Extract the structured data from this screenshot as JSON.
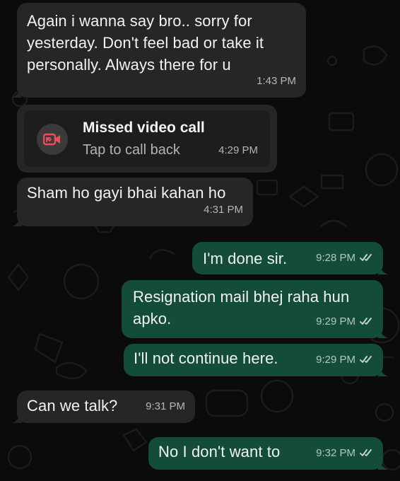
{
  "conversation": {
    "messages": [
      {
        "direction": "incoming",
        "text": "Again i wanna say bro.. sorry for yesterday. Don't feel bad or take it personally. Always there for u",
        "time": "1:43 PM"
      },
      {
        "direction": "incoming",
        "type": "missed-call",
        "title": "Missed video call",
        "subtitle": "Tap to call back",
        "time": "4:29 PM"
      },
      {
        "direction": "incoming",
        "text": "Sham ho gayi bhai kahan ho",
        "time": "4:31 PM"
      },
      {
        "direction": "outgoing",
        "text": "I'm done sir.",
        "time": "9:28 PM"
      },
      {
        "direction": "outgoing",
        "text": "Resignation mail bhej raha hun apko.",
        "time": "9:29 PM"
      },
      {
        "direction": "outgoing",
        "text": "I'll not continue here.",
        "time": "9:29 PM"
      },
      {
        "direction": "incoming",
        "text": "Can we talk?",
        "time": "9:31 PM"
      },
      {
        "direction": "outgoing",
        "text": "No I don't want to",
        "time": "9:32 PM"
      }
    ]
  },
  "theme": {
    "background": "#0b0b0b",
    "incoming_bubble": "#262627",
    "outgoing_bubble": "#134d37",
    "missed_call_icon": "#f04b58"
  },
  "icons": {
    "missed_call": "missed-video-call-icon",
    "read_receipt": "double-check-icon"
  }
}
